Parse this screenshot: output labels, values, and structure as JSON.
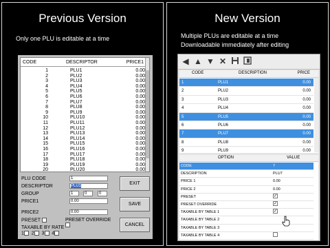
{
  "left": {
    "title": "Previous Version",
    "description": "Only one PLU is editable at a time",
    "list": {
      "headers": [
        "CODE",
        "DESCRIPTOR",
        "PRICE1"
      ],
      "rows": [
        [
          "1",
          "PLU1",
          "0.00"
        ],
        [
          "2",
          "PLU2",
          "0.00"
        ],
        [
          "3",
          "PLU3",
          "0.00"
        ],
        [
          "4",
          "PLU4",
          "0.00"
        ],
        [
          "5",
          "PLU5",
          "0.00"
        ],
        [
          "6",
          "PLU6",
          "0.00"
        ],
        [
          "7",
          "PLU7",
          "0.00"
        ],
        [
          "8",
          "PLU8",
          "0.00"
        ],
        [
          "9",
          "PLU9",
          "0.00"
        ],
        [
          "10",
          "PLU10",
          "0.00"
        ],
        [
          "11",
          "PLU11",
          "0.00"
        ],
        [
          "12",
          "PLU12",
          "0.00"
        ],
        [
          "13",
          "PLU13",
          "0.00"
        ],
        [
          "14",
          "PLU14",
          "0.00"
        ],
        [
          "15",
          "PLU15",
          "0.00"
        ],
        [
          "16",
          "PLU16",
          "0.00"
        ],
        [
          "17",
          "PLU17",
          "0.00"
        ],
        [
          "18",
          "PLU18",
          "0.00"
        ],
        [
          "19",
          "PLU19",
          "0.00"
        ],
        [
          "20",
          "PLU20",
          "0.00"
        ]
      ]
    },
    "form": {
      "plu_code_label": "PLU CODE",
      "plu_code_value": "1",
      "descriptor_label": "DESCRIPTOR",
      "descriptor_value": "PLU1",
      "group_label": "GROUP",
      "group_values": [
        "1",
        "0",
        "0"
      ],
      "price1_label": "PRICE1",
      "price1_value": "0.00",
      "price2_label": "PRICE2",
      "price2_value": "0.00",
      "preset_label": "PRESET",
      "preset_override_label": "PRESET OVERRIDE",
      "taxable_label": "TAXABLE BY RATE",
      "tax_rates": [
        "1",
        "2",
        "3",
        "4"
      ]
    },
    "buttons": {
      "exit": "EXIT",
      "save": "SAVE",
      "cancel": "CANCEL"
    }
  },
  "right": {
    "title": "New Version",
    "description_line1": "Multiple PLUs are editable at a time",
    "description_line2": "Downloadable immediately after editing",
    "toolbar_icons": [
      "arrow-left-icon",
      "arrow-up-icon",
      "arrow-down-icon",
      "delete-icon",
      "save-icon",
      "export-icon"
    ],
    "list": {
      "headers": [
        "CODE",
        "DESCRIPTION",
        "PRICE"
      ],
      "rows": [
        {
          "code": "1",
          "desc": "PLU1",
          "price": "0.00",
          "selected": true
        },
        {
          "code": "2",
          "desc": "PLU2",
          "price": "0.00",
          "selected": false
        },
        {
          "code": "3",
          "desc": "PLU3",
          "price": "0.00",
          "selected": false
        },
        {
          "code": "4",
          "desc": "PLU4",
          "price": "0.00",
          "selected": false
        },
        {
          "code": "5",
          "desc": "PLU5",
          "price": "0.00",
          "selected": true
        },
        {
          "code": "6",
          "desc": "PLU6",
          "price": "0.00",
          "selected": false
        },
        {
          "code": "7",
          "desc": "PLU7",
          "price": "0.00",
          "selected": true
        },
        {
          "code": "8",
          "desc": "PLU8",
          "price": "0.00",
          "selected": false
        },
        {
          "code": "9",
          "desc": "PLU9",
          "price": "0.00",
          "selected": false
        }
      ]
    },
    "options": {
      "headers": [
        "OPTION",
        "VALUE"
      ],
      "rows": [
        {
          "option": "CODE",
          "value": "7",
          "kind": "text",
          "selected": true
        },
        {
          "option": "DESCRIPTION",
          "value": "PLU7",
          "kind": "text",
          "selected": false
        },
        {
          "option": "PRICE 1",
          "value": "0.00",
          "kind": "text",
          "selected": false
        },
        {
          "option": "PRICE 2",
          "value": "0.00",
          "kind": "text",
          "selected": false
        },
        {
          "option": "PRESET",
          "value": "checked",
          "kind": "check",
          "selected": false
        },
        {
          "option": "PRESET OVERRIDE",
          "value": "checked",
          "kind": "check",
          "selected": false
        },
        {
          "option": "TAXABLE BY TABLE 1",
          "value": "checked",
          "kind": "check",
          "selected": false
        },
        {
          "option": "TAXABLE BY TABLE 2",
          "value": "",
          "kind": "none",
          "selected": false
        },
        {
          "option": "TAXABLE BY TABLE 3",
          "value": "",
          "kind": "none",
          "selected": false
        },
        {
          "option": "TAXABLE BY TABLE 4",
          "value": "unchecked",
          "kind": "check",
          "selected": false
        }
      ]
    }
  },
  "colors": {
    "selection": "#3e8fe0",
    "background": "#000000",
    "panel_border": "#d9d9d9"
  }
}
